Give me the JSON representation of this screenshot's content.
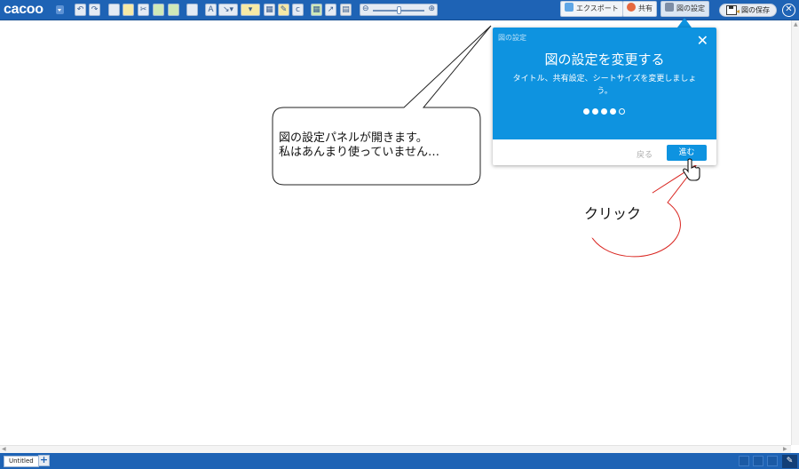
{
  "app": {
    "logo": "cacoo"
  },
  "toolbar": {
    "export_label": "エクスポート",
    "share_label": "共有",
    "diagram_settings_label": "図の設定",
    "save_label": "図の保存"
  },
  "popover": {
    "breadcrumb": "図の設定",
    "title": "図の設定を変更する",
    "description": "タイトル、共有設定、シートサイズを変更しましょう。",
    "close": "✕",
    "back_label": "戻る",
    "next_label": "進む",
    "step_current": 4,
    "step_total": 5
  },
  "annotations": {
    "callout_line1": "図の設定パネルが開きます。",
    "callout_line2": "私はあんまり使っていません…",
    "click_label": "クリック"
  },
  "sheets": {
    "tab_label": "Untitled",
    "add": "+"
  },
  "colors": {
    "brand_bar": "#1e63b5",
    "popover_blue": "#0e93e0"
  }
}
